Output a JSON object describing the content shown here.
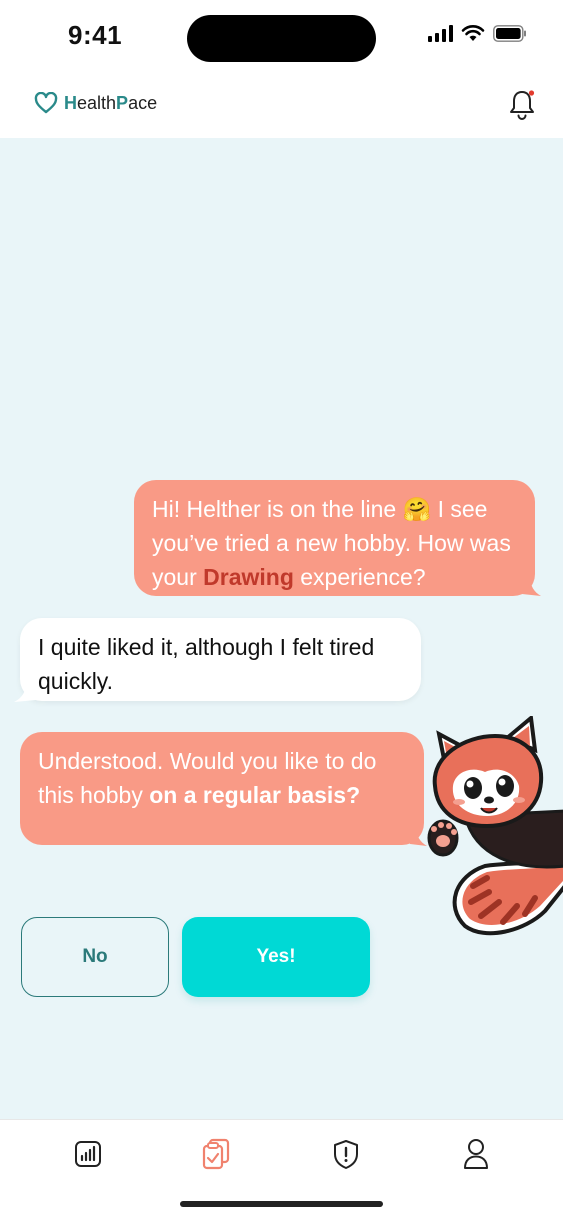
{
  "status_bar": {
    "time": "9:41"
  },
  "app": {
    "brand_h": "H",
    "brand_ealth": "ealth",
    "brand_p": "P",
    "brand_ace": "ace"
  },
  "chat": {
    "bot_message_1": {
      "part1": "Hi! Helther is on the line ",
      "emoji": "🤗",
      "part2": " I see you’ve tried a new hobby. How was your ",
      "highlight": "Drawing",
      "part3": " experience?"
    },
    "user_message_1": "I quite liked it, although I felt tired quickly.",
    "bot_message_2": {
      "part1": "Understood. Would you like to do this hobby ",
      "bold": "on a regular basis?"
    }
  },
  "actions": {
    "no_label": "No",
    "yes_label": "Yes!"
  },
  "nav": {
    "items": [
      {
        "icon": "stats-chart-icon",
        "active": false
      },
      {
        "icon": "clipboard-check-icon",
        "active": true
      },
      {
        "icon": "shield-alert-icon",
        "active": false
      },
      {
        "icon": "user-icon",
        "active": false
      }
    ]
  },
  "colors": {
    "accent_teal": "#00d9d5",
    "bot_bubble": "#f99a86",
    "chat_background": "#e9f5f8",
    "active_nav": "#f0826e"
  }
}
